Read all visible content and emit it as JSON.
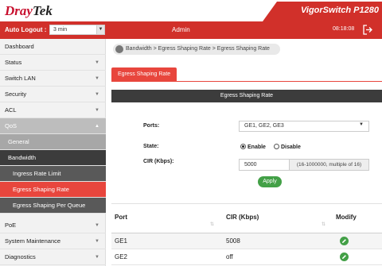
{
  "header": {
    "brand_red": "Dray",
    "brand_dark": "Tek",
    "model": "VigorSwitch P1280",
    "auto_logout_label": "Auto Logout :",
    "auto_logout_value": "3 min",
    "user": "Admin",
    "time": "08:18:08"
  },
  "sidebar": {
    "items": [
      {
        "label": "Dashboard",
        "chevron": false
      },
      {
        "label": "Status",
        "chevron": true
      },
      {
        "label": "Switch LAN",
        "chevron": true
      },
      {
        "label": "Security",
        "chevron": true
      },
      {
        "label": "ACL",
        "chevron": true
      },
      {
        "label": "QoS",
        "chevron": true
      },
      {
        "label": "General",
        "chevron": false
      },
      {
        "label": "Bandwidth",
        "chevron": false
      },
      {
        "label": "Ingress Rate Limit",
        "chevron": false
      },
      {
        "label": "Egress Shaping Rate",
        "chevron": false
      },
      {
        "label": "Egress Shaping Per Queue",
        "chevron": false
      },
      {
        "label": "PoE",
        "chevron": true
      },
      {
        "label": "System Maintenance",
        "chevron": true
      },
      {
        "label": "Diagnostics",
        "chevron": true
      }
    ]
  },
  "breadcrumb": "Bandwidth > Egress Shaping Rate > Egress Shaping Rate",
  "tab_label": "Egress Shaping Rate",
  "panel_title": "Egress Shaping Rate",
  "form": {
    "ports_label": "Ports:",
    "ports_value": "GE1, GE2, GE3",
    "state_label": "State:",
    "enable_label": "Enable",
    "disable_label": "Disable",
    "cir_label": "CIR (Kbps):",
    "cir_value": "5000",
    "cir_hint": "(16-1000000, multiple of 16)",
    "apply_label": "Apply"
  },
  "table": {
    "headers": [
      "Port",
      "CIR (Kbps)",
      "Modify"
    ],
    "rows": [
      {
        "port": "GE1",
        "cir": "5008"
      },
      {
        "port": "GE2",
        "cir": "off"
      }
    ]
  },
  "colors": {
    "accent": "#d1302a",
    "active": "#e8463d",
    "apply": "#43a047"
  }
}
